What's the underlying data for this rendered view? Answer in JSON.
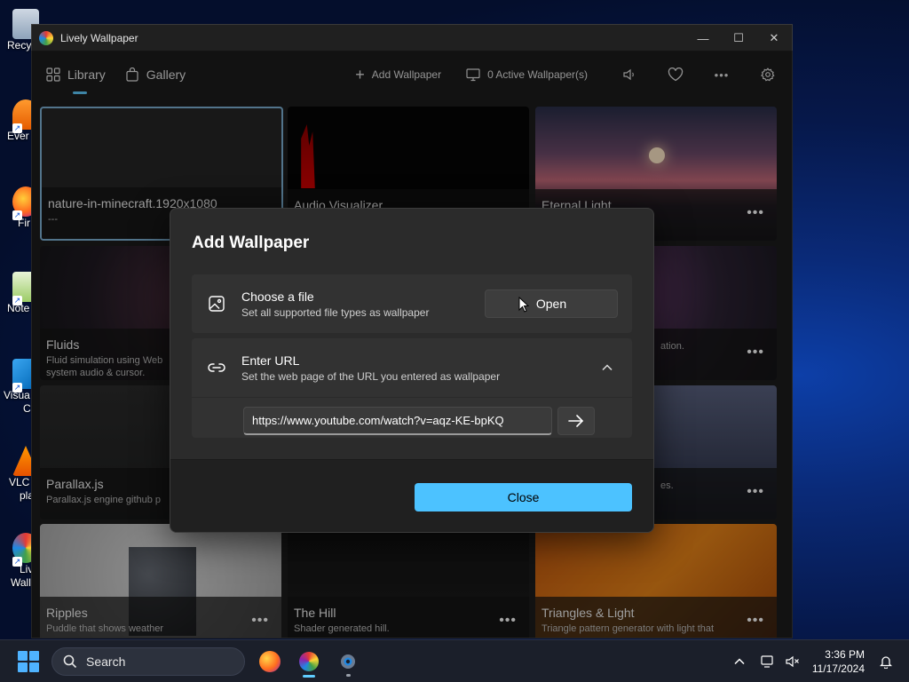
{
  "desktop": {
    "icons": [
      {
        "label": "Recy",
        "icon": "recycle-bin-icon"
      },
      {
        "label": "Ever",
        "icon": "everything-app-icon"
      },
      {
        "label": "Fir",
        "icon": "firefox-desktop-icon"
      },
      {
        "label": "Note",
        "icon": "notepad-icon"
      },
      {
        "label": "Visua",
        "label2": "C",
        "icon": "vscode-icon"
      },
      {
        "label": "VLC",
        "label2": "pla",
        "icon": "vlc-icon"
      },
      {
        "label": "Liv",
        "label2": "Wall",
        "icon": "lively-desktop-icon"
      }
    ]
  },
  "window": {
    "title": "Lively Wallpaper",
    "controls": [
      "—",
      "☐",
      "✕"
    ]
  },
  "nav": {
    "library": "Library",
    "gallery": "Gallery",
    "add_wallpaper": "Add Wallpaper",
    "active_wallpapers": "0 Active Wallpaper(s)",
    "more": "•••"
  },
  "tiles": [
    {
      "title": "nature-in-minecraft.1920x1080",
      "desc": "---"
    },
    {
      "title": "Audio Visualizer",
      "desc": ""
    },
    {
      "title": "Eternal Light",
      "desc": ""
    },
    {
      "title": "Fluids",
      "desc": "Fluid simulation using Web",
      "desc2": "system audio & cursor."
    },
    {
      "title": "",
      "desc": "ation."
    },
    {
      "title": "Parallax.js",
      "desc": "Parallax.js engine github p"
    },
    {
      "title": "",
      "desc": "es."
    },
    {
      "title": "Ripples",
      "desc": "Puddle that shows weather"
    },
    {
      "title": "The Hill",
      "desc": "Shader generated hill."
    },
    {
      "title": "Triangles & Light",
      "desc": "Triangle pattern generator with light that"
    }
  ],
  "dialog": {
    "title": "Add Wallpaper",
    "file": {
      "title": "Choose a file",
      "subtitle": "Set all supported file types as wallpaper",
      "button": "Open"
    },
    "url": {
      "title": "Enter URL",
      "subtitle": "Set the web page of the URL you entered as wallpaper",
      "value": "https://www.youtube.com/watch?v=aqz-KE-bpKQ"
    },
    "close": "Close"
  },
  "taskbar": {
    "search": "Search",
    "time": "3:36 PM",
    "date": "11/17/2024"
  },
  "colors": {
    "accent": "#4cc2ff",
    "window_bg": "#1c1c1c",
    "dialog_bg": "#2b2b2b"
  }
}
